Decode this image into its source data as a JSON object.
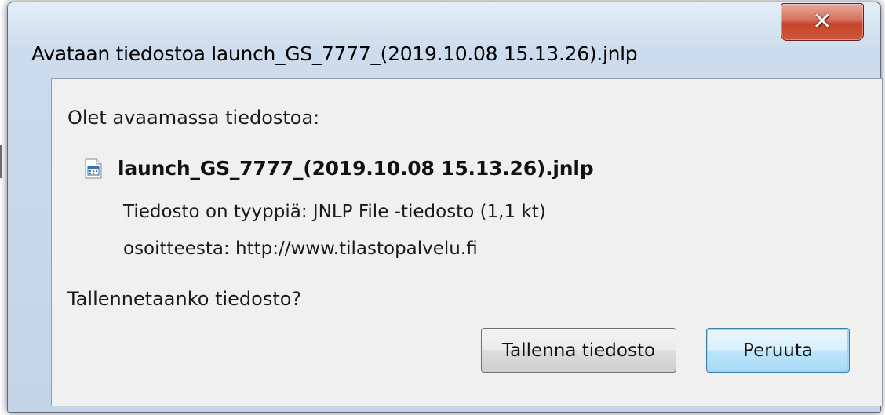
{
  "dialog": {
    "title": "Avataan tiedostoa launch_GS_7777_(2019.10.08 15.13.26).jnlp",
    "close_icon": "close-x-icon",
    "prompt": "Olet avaamassa tiedostoa:",
    "file": {
      "icon": "jnlp-file-icon",
      "name": "launch_GS_7777_(2019.10.08 15.13.26).jnlp",
      "type_line": "Tiedosto on tyyppiä:  JNLP File -tiedosto (1,1 kt)",
      "source_line": "osoitteesta:  http://www.tilastopalvelu.fi"
    },
    "question": "Tallennetaanko tiedosto?",
    "buttons": {
      "save_label": "Tallenna tiedosto",
      "cancel_label": "Peruuta"
    }
  },
  "colors": {
    "window_frame": "#cddcec",
    "content_bg": "#f0f0f0",
    "close_button": "#c4432a",
    "focused_button_border": "#3c7fb1"
  }
}
